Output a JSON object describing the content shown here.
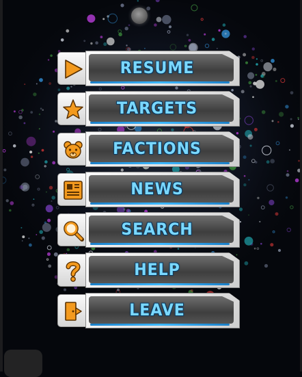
{
  "menu": {
    "items": [
      {
        "label": "RESUME",
        "icon": "play-icon"
      },
      {
        "label": "TARGETS",
        "icon": "star-icon"
      },
      {
        "label": "FACTIONS",
        "icon": "bear-icon"
      },
      {
        "label": "NEWS",
        "icon": "newspaper-icon"
      },
      {
        "label": "SEARCH",
        "icon": "magnifier-icon"
      },
      {
        "label": "HELP",
        "icon": "question-mark-icon"
      },
      {
        "label": "LEAVE",
        "icon": "exit-door-icon"
      }
    ]
  },
  "colors": {
    "label_text": "#7ad8ff",
    "label_outline": "#0a3a60",
    "accent_bar": "#3cb8ff",
    "icon_orange": "#f39a1e",
    "background": "#05070c"
  }
}
